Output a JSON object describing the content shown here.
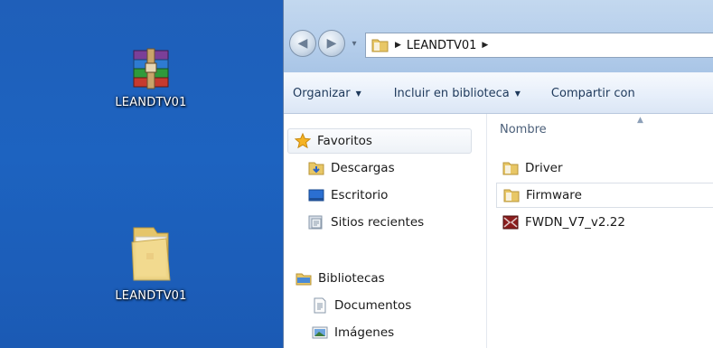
{
  "desktop": {
    "icons": [
      {
        "label": "LEANDTV01",
        "icon": "winrar-archive-icon"
      },
      {
        "label": "LEANDTV01",
        "icon": "folder-icon"
      }
    ]
  },
  "explorer": {
    "address": {
      "path": "LEANDTV01"
    },
    "toolbar": {
      "organize": "Organizar",
      "include_library": "Incluir en biblioteca",
      "share_with": "Compartir con"
    },
    "nav": {
      "favorites": "Favoritos",
      "downloads": "Descargas",
      "desktop": "Escritorio",
      "recent_places": "Sitios recientes",
      "libraries": "Bibliotecas",
      "documents": "Documentos",
      "images": "Imágenes"
    },
    "files": {
      "column_name": "Nombre",
      "items": [
        "Driver",
        "Firmware",
        "FWDN_V7_v2.22"
      ]
    }
  }
}
